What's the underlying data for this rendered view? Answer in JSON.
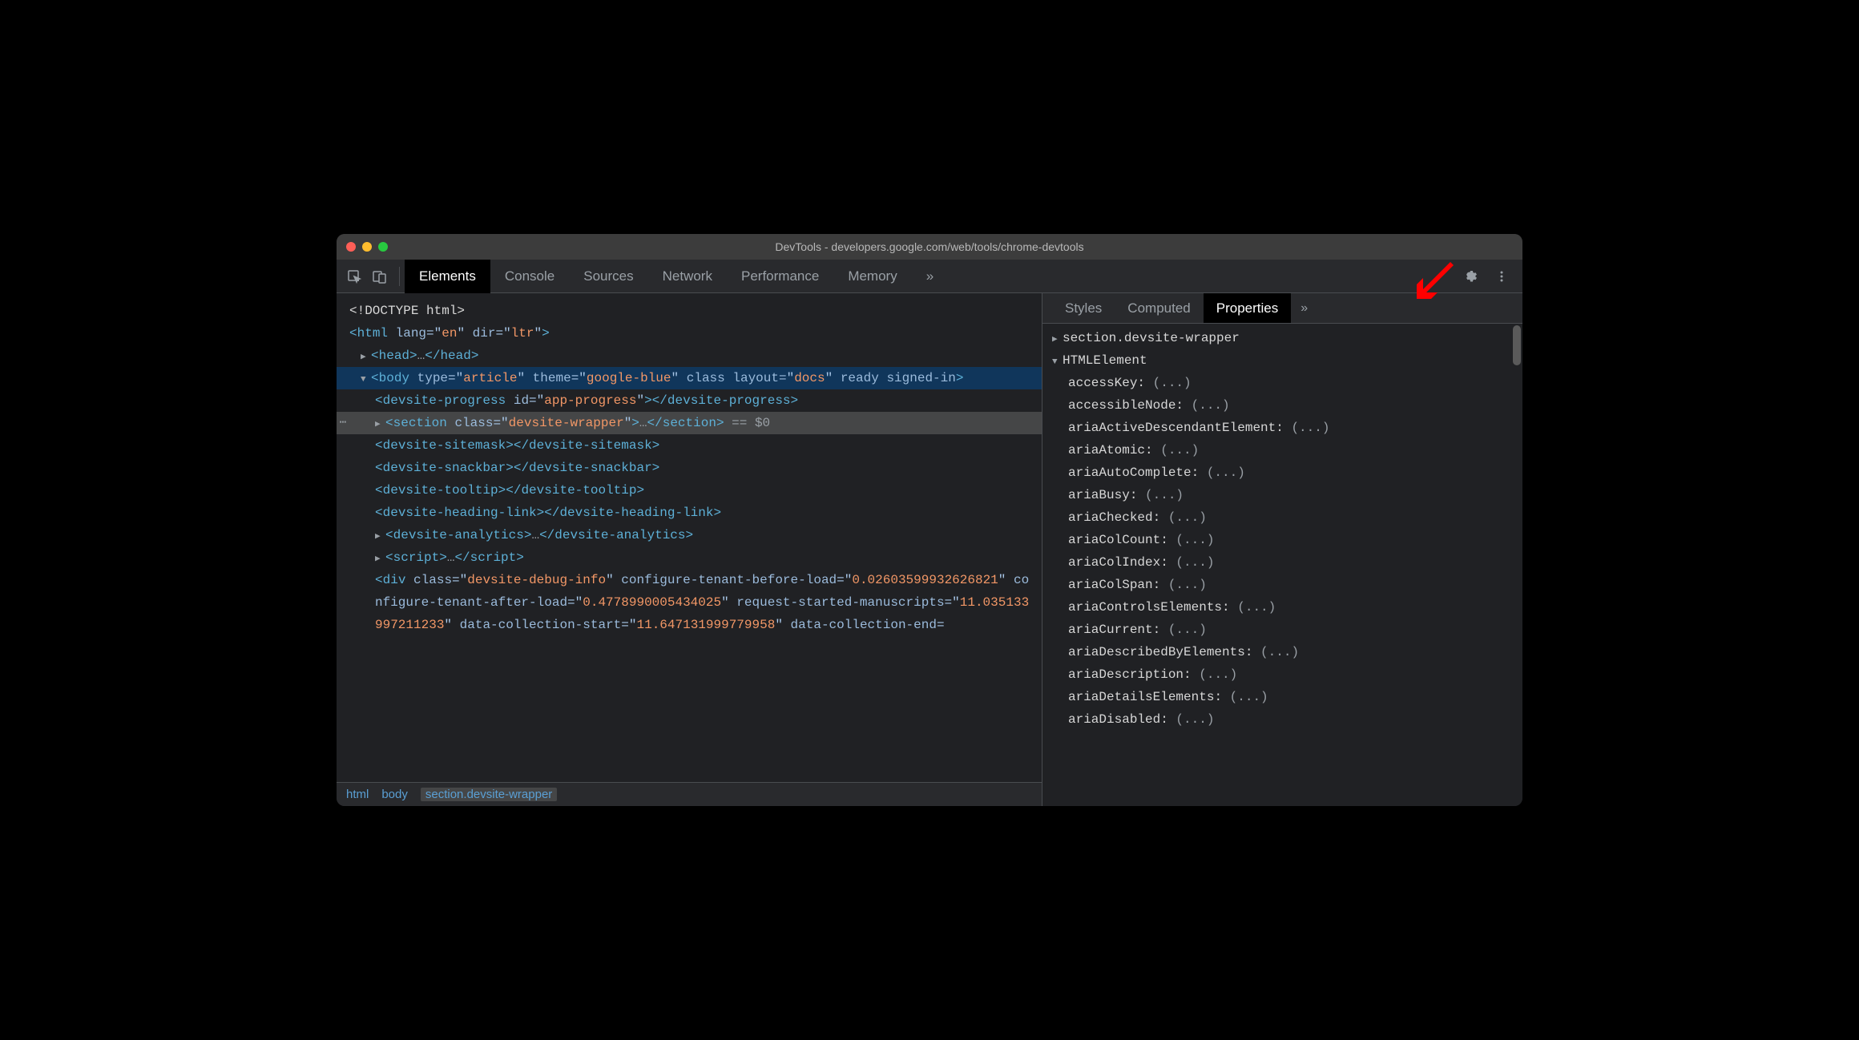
{
  "window_title": "DevTools - developers.google.com/web/tools/chrome-devtools",
  "main_tabs": [
    "Elements",
    "Console",
    "Sources",
    "Network",
    "Performance",
    "Memory"
  ],
  "main_tabs_more": "»",
  "dom": {
    "doctype": "<!DOCTYPE html>",
    "html_open": {
      "tag": "html",
      "attrs": [
        {
          "n": "lang",
          "v": "en"
        },
        {
          "n": "dir",
          "v": "ltr"
        }
      ]
    },
    "head": {
      "tag": "head",
      "ellipsis": "…"
    },
    "body": {
      "tag": "body",
      "attrs": [
        {
          "n": "type",
          "v": "article"
        },
        {
          "n": "theme",
          "v": "google-blue"
        }
      ],
      "flags": [
        "class",
        "layout="
      ],
      "val2": "docs",
      "flags2": [
        "ready",
        "signed-in"
      ]
    },
    "progress": {
      "tag": "devsite-progress",
      "attr": {
        "n": "id",
        "v": "app-progress"
      }
    },
    "section": {
      "tag": "section",
      "attr": {
        "n": "class",
        "v": "devsite-wrapper"
      },
      "ellipsis": "…",
      "suffix": " == $0"
    },
    "sitemask": {
      "tag": "devsite-sitemask"
    },
    "snackbar": {
      "tag": "devsite-snackbar"
    },
    "tooltip": {
      "tag": "devsite-tooltip"
    },
    "heading_link": {
      "tag": "devsite-heading-link"
    },
    "analytics": {
      "tag": "devsite-analytics",
      "ellipsis": "…"
    },
    "script": {
      "tag": "script",
      "ellipsis": "…"
    },
    "div": {
      "tag": "div",
      "attrs": [
        {
          "n": "class",
          "v": "devsite-debug-info"
        },
        {
          "n": "configure-tenant-before-load",
          "v": "0.02603599932626821"
        },
        {
          "n": "configure-tenant-after-load",
          "v": "0.4778990005434025"
        },
        {
          "n": "request-started-manuscripts",
          "v": "11.035133997211233"
        },
        {
          "n": "data-collection-start",
          "v": "11.647131999779958"
        },
        {
          "n": "data-collection-end"
        }
      ]
    }
  },
  "breadcrumb": [
    "html",
    "body",
    "section.devsite-wrapper"
  ],
  "side_tabs": [
    "Styles",
    "Computed",
    "Properties"
  ],
  "side_tabs_more": "»",
  "props_header": "section.devsite-wrapper",
  "props_proto": "HTMLElement",
  "props": [
    "accessKey",
    "accessibleNode",
    "ariaActiveDescendantElement",
    "ariaAtomic",
    "ariaAutoComplete",
    "ariaBusy",
    "ariaChecked",
    "ariaColCount",
    "ariaColIndex",
    "ariaColSpan",
    "ariaControlsElements",
    "ariaCurrent",
    "ariaDescribedByElements",
    "ariaDescription",
    "ariaDetailsElements",
    "ariaDisabled"
  ],
  "prop_value_placeholder": "(...)"
}
